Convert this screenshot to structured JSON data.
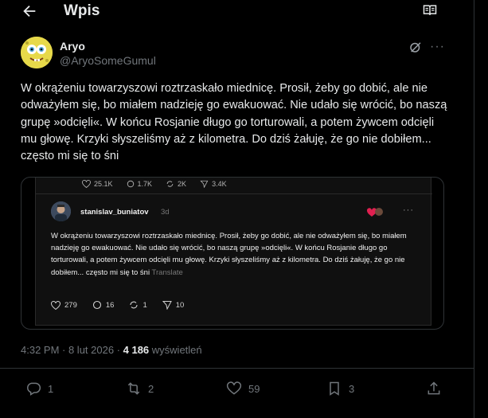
{
  "header": {
    "title": "Wpis",
    "back_icon": "arrow-left-icon",
    "reader_icon": "book-open-icon"
  },
  "post": {
    "author_name": "Aryo",
    "author_handle": "@AryoSomeGumul",
    "text": "W okrążeniu towarzyszowi roztrzaskało miednicę. Prosił, żeby go dobić, ale nie odważyłem się, bo miałem nadzieję go ewakuować. Nie udało się wrócić, bo naszą grupę »odcięli«. W końcu Rosjanie długo go torturowali, a potem żywcem odcięli mu głowę. Krzyki słyszeliśmy aż z kilometra. Do dziś żałuję, że go nie dobiłem... często mi się to śni",
    "time": "4:32 PM · 8 lut 2026 · ",
    "views_count": "4 186",
    "views_label": " wyświetleń"
  },
  "embed": {
    "top_stats": {
      "likes": "25.1K",
      "replies": "1.7K",
      "reposts": "2K",
      "shares": "3.4K"
    },
    "username": "stanislav_buniatov",
    "ago": "3d",
    "text": "W okrążeniu towarzyszowi roztrzaskało miednicę. Prosił, żeby go dobić, ale nie odważyłem się, bo miałem nadzieję go ewakuować. Nie udało się wrócić, bo naszą grupę »odcięli«. W końcu Rosjanie długo go torturowali, a potem żywcem odcięli mu głowę. Krzyki słyszeliśmy aż z kilometra. Do dziś żałuję, że go nie dobiłem... często mi się to śni",
    "translate": "Translate",
    "actions": {
      "likes": "279",
      "replies": "16",
      "reposts": "1",
      "shares": "10"
    }
  },
  "actions": {
    "replies": "1",
    "reposts": "2",
    "likes": "59",
    "bookmarks": "3"
  },
  "colors": {
    "background": "#000000",
    "text": "#e7e9ea",
    "muted": "#71767b",
    "border": "#2f3336"
  }
}
